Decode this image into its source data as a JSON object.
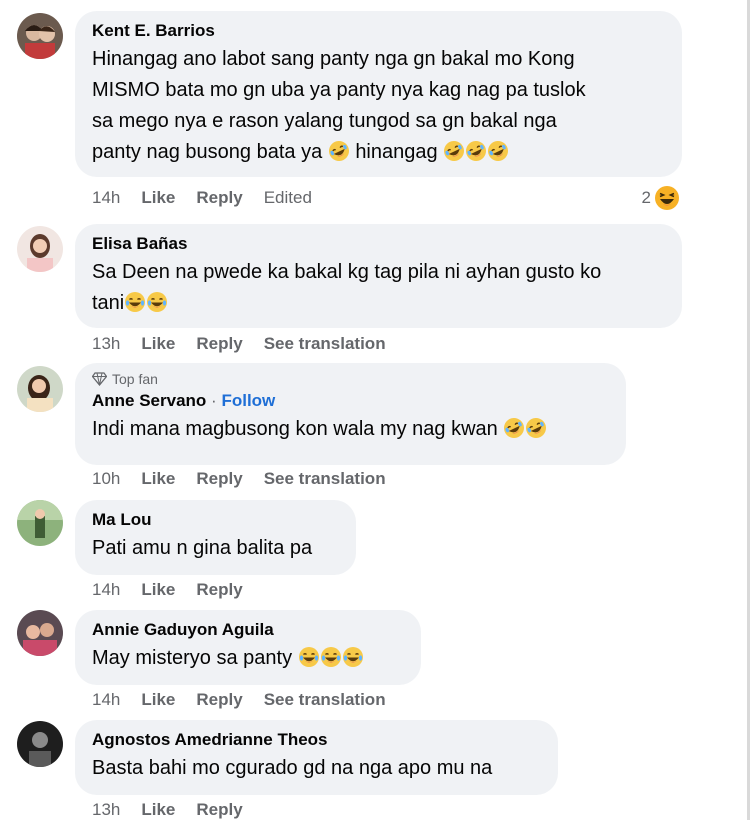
{
  "colors": {
    "bubble_bg": "#f0f2f5",
    "meta_text": "#65676b",
    "follow_link": "#1f6fd6",
    "emoji_yellow": "#f7c948"
  },
  "comments": [
    {
      "author": "Kent E. Barrios",
      "text_lines": [
        "Hinangag ano labot sang panty nga gn bakal mo Kong",
        "MISMO bata mo gn uba ya panty nya kag nag pa tuslok",
        "sa mego nya e rason yalang tungod sa gn bakal nga",
        "panty nag busong bata ya"
      ],
      "text_tail": "hinangag",
      "time": "14h",
      "like": "Like",
      "reply": "Reply",
      "extra": "Edited",
      "reaction_count": "2",
      "reaction_icon": "laughing-reaction-icon"
    },
    {
      "author": "Elisa Bañas",
      "text_lines": [
        "Sa Deen na pwede ka bakal kg tag pila ni ayhan gusto ko",
        "tani"
      ],
      "time": "13h",
      "like": "Like",
      "reply": "Reply",
      "extra": "See translation"
    },
    {
      "badge": "Top fan",
      "badge_icon": "diamond-icon",
      "author": "Anne Servano",
      "separator": "·",
      "follow": "Follow",
      "text": "Indi mana magbusong kon wala my nag kwan",
      "time": "10h",
      "like": "Like",
      "reply": "Reply",
      "extra": "See translation"
    },
    {
      "author": "Ma Lou",
      "text": "Pati amu n gina balita pa",
      "time": "14h",
      "like": "Like",
      "reply": "Reply"
    },
    {
      "author": "Annie Gaduyon Aguila",
      "text": "May misteryo sa panty",
      "time": "14h",
      "like": "Like",
      "reply": "Reply",
      "extra": "See translation"
    },
    {
      "author": "Agnostos Amedrianne Theos",
      "text": "Basta bahi mo cgurado gd na nga apo mu na",
      "time": "13h",
      "like": "Like",
      "reply": "Reply"
    }
  ]
}
